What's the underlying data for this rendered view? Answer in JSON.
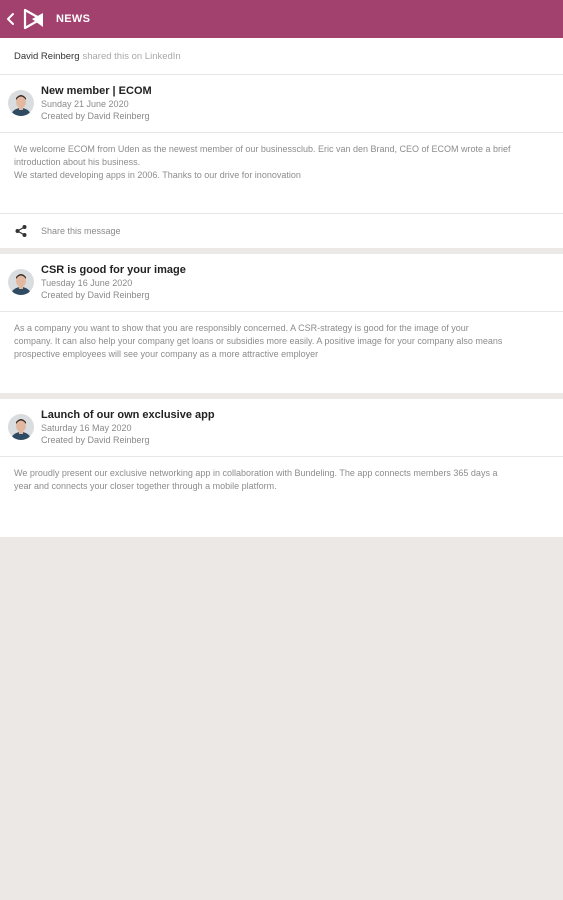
{
  "header": {
    "title": "NEWS",
    "back_icon": "chevron-left-icon",
    "logo": "app-logo"
  },
  "colors": {
    "brand": "#a3416e",
    "background": "#ebe8e5"
  },
  "posts": [
    {
      "shared": {
        "author": "David Reinberg",
        "text": "shared this on LinkedIn"
      },
      "title": "New member | ECOM",
      "date": "Sunday 21 June 2020",
      "creator": "Created by David Reinberg",
      "body": [
        "We welcome ECOM from Uden as the newest member of our businessclub. Eric van den Brand, CEO of ECOM wrote a brief",
        "introduction about his business.",
        "We started developing apps in 2006. Thanks to our drive for inonovation"
      ],
      "share_label": "Share this message"
    },
    {
      "title": "CSR is good for your image",
      "date": "Tuesday 16 June 2020",
      "creator": "Created by David Reinberg",
      "body": [
        "As a company you want to show that you are responsibly concerned. A CSR-strategy is good for the image of your",
        "company. It can also help your company get loans or subsidies more easily. A positive image for your company also means",
        "prospective employees will see your company as a more attractive employer"
      ]
    },
    {
      "title": "Launch of our own exclusive app",
      "date": "Saturday 16 May 2020",
      "creator": "Created by David Reinberg",
      "body": [
        "We proudly present our exclusive networking app in collaboration with Bundeling. The app connects members 365 days a",
        "year and connects your closer together through a mobile platform."
      ]
    }
  ]
}
